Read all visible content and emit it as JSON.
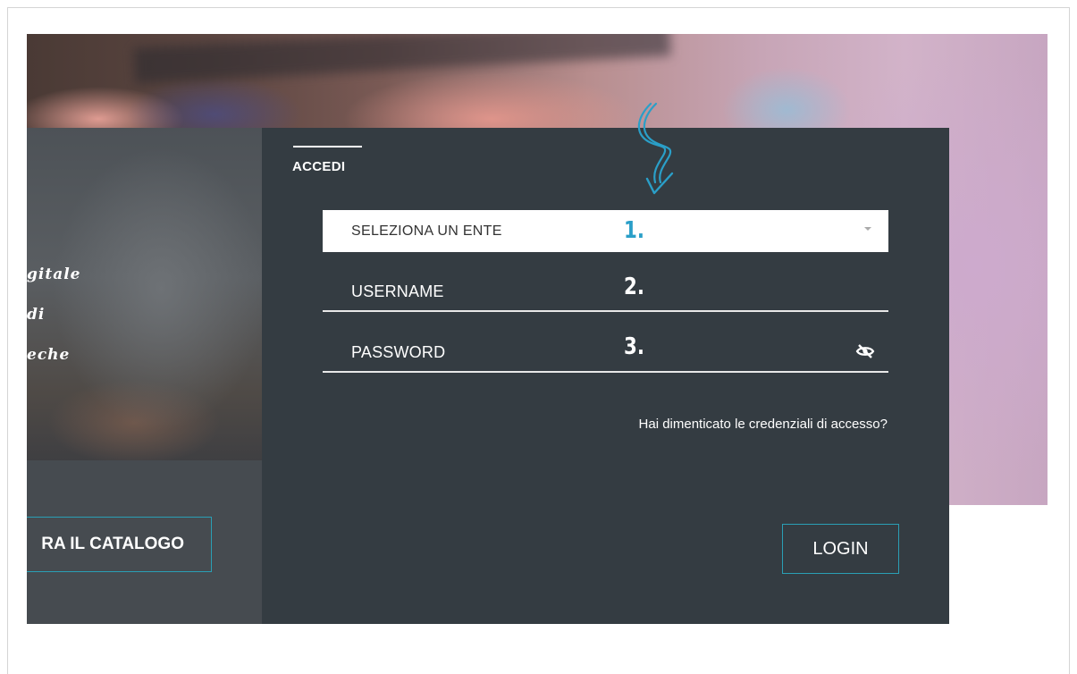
{
  "left_panel": {
    "tagline": [
      "gitale",
      "di",
      "eche"
    ],
    "catalog_button": "RA IL CATALOGO"
  },
  "login_form": {
    "heading": "ACCEDI",
    "select": {
      "placeholder": "SELEZIONA UN ENTE"
    },
    "username": {
      "label": "USERNAME"
    },
    "password": {
      "label": "PASSWORD"
    },
    "forgot_link": "Hai dimenticato le credenziali di accesso?",
    "login_button": "LOGIN"
  },
  "annotations": {
    "step1": "1.",
    "step2": "2.",
    "step3": "3.",
    "arrow_icon": "curly-arrow-down-icon",
    "accent_color": "#2a9fc8"
  },
  "icons": {
    "password_toggle": "eye-slash-icon",
    "select_caret": "caret-down-icon"
  },
  "colors": {
    "panel_dark": "#343c42",
    "panel_left": "#464b50",
    "button_border": "#2a9fb5"
  }
}
